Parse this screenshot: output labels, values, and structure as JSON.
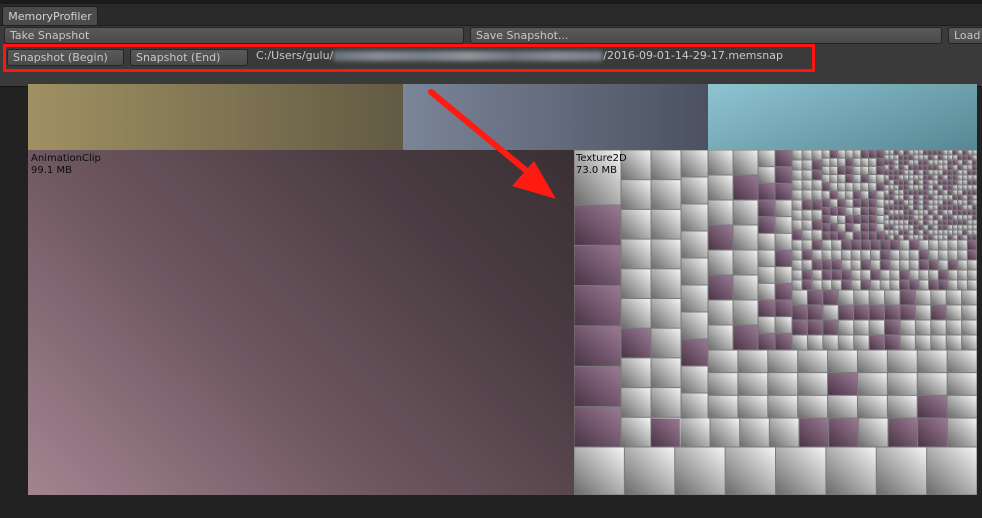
{
  "window": {
    "tab_label": "MemoryProfiler"
  },
  "toolbar": {
    "take_snapshot_label": "Take Snapshot",
    "save_snapshot_label": "Save Snapshot...",
    "load_label": "Load",
    "snapshot_begin_label": "Snapshot (Begin)",
    "snapshot_end_label": "Snapshot (End)",
    "path_prefix": "C:/Users/gulu/",
    "path_suffix": "/2016-09-01-14-29-17.memsnap"
  },
  "treemap": {
    "animation_clip": {
      "name": "AnimationClip",
      "size": "99.1 MB"
    },
    "texture2d": {
      "name": "Texture2D",
      "size": "73.0 MB"
    }
  },
  "colors": {
    "highlight": "#ff1414",
    "arrow": "#ff1a12"
  }
}
